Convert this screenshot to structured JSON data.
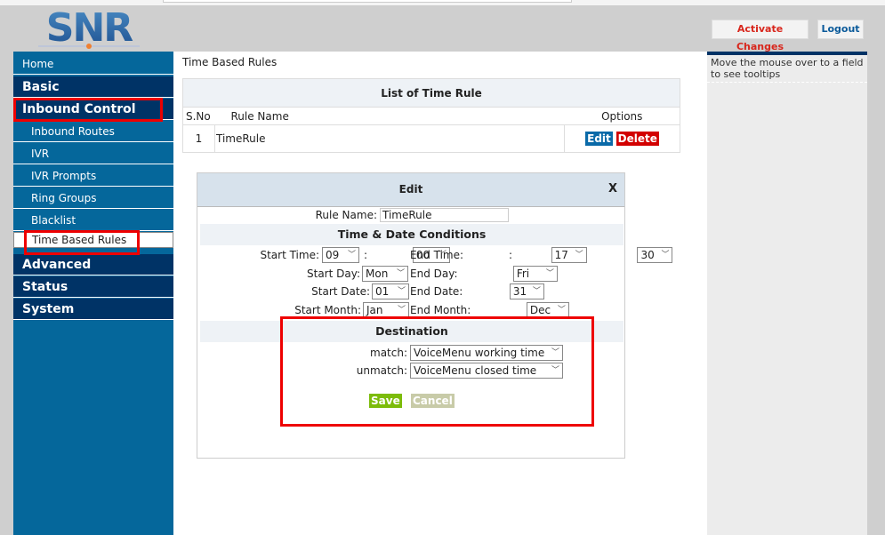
{
  "header": {
    "logo_text": "SNR",
    "activate_label": "Activate Changes",
    "logout_label": "Logout"
  },
  "sidebar": {
    "items": [
      {
        "label": "Home"
      },
      {
        "label": "Basic"
      },
      {
        "label": "Inbound Control"
      },
      {
        "label": "Inbound Routes"
      },
      {
        "label": "IVR"
      },
      {
        "label": "IVR Prompts"
      },
      {
        "label": "Ring Groups"
      },
      {
        "label": "Blacklist"
      },
      {
        "label": "Time Based Rules"
      },
      {
        "label": "Advanced"
      },
      {
        "label": "Status"
      },
      {
        "label": "System"
      }
    ]
  },
  "main": {
    "title": "Time Based Rules",
    "list": {
      "title": "List of Time Rule",
      "headers": [
        "S.No",
        "Rule Name",
        "Options"
      ],
      "rows": [
        {
          "sno": "1",
          "name": "TimeRule",
          "edit": "Edit",
          "delete": "Delete"
        }
      ]
    }
  },
  "edit": {
    "title": "Edit",
    "close": "X",
    "rule_name_label": "Rule Name:",
    "rule_name_value": "TimeRule",
    "conditions_title": "Time & Date Conditions",
    "start_time_label": "Start Time:",
    "start_hour": "09",
    "start_min": "00",
    "colon": ":",
    "end_time_label": "End Time:",
    "end_hour": "17",
    "end_min": "30",
    "start_day_label": "Start Day:",
    "start_day": "Mon",
    "end_day_label": "End Day:",
    "end_day": "Fri",
    "start_date_label": "Start Date:",
    "start_date": "01",
    "end_date_label": "End Date:",
    "end_date": "31",
    "start_month_label": "Start Month:",
    "start_month": "Jan",
    "end_month_label": "End Month:",
    "end_month": "Dec",
    "destination_title": "Destination",
    "match_label": "match:",
    "match_value": "VoiceMenu working time",
    "unmatch_label": "unmatch:",
    "unmatch_value": "VoiceMenu closed time",
    "save": "Save",
    "cancel": "Cancel"
  },
  "tooltip": "Move the mouse over to a field to see tooltips",
  "colors": {
    "nav_dark": "#003366",
    "nav_blue": "#05679b",
    "highlight": "#e00000",
    "save": "#7cbc0a"
  }
}
